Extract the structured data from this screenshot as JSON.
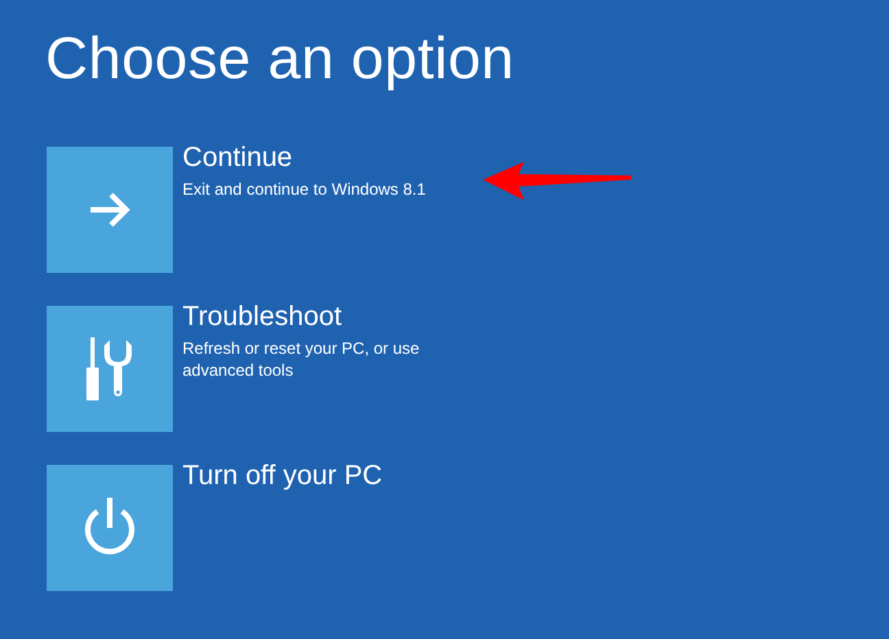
{
  "title": "Choose an option",
  "options": [
    {
      "kind": "continue",
      "label": "Continue",
      "description": "Exit and continue to Windows 8.1",
      "highlighted": true
    },
    {
      "kind": "troubleshoot",
      "label": "Troubleshoot",
      "description": "Refresh or reset your PC, or use advanced tools",
      "highlighted": false
    },
    {
      "kind": "power",
      "label": "Turn off your PC",
      "highlighted": false
    }
  ]
}
